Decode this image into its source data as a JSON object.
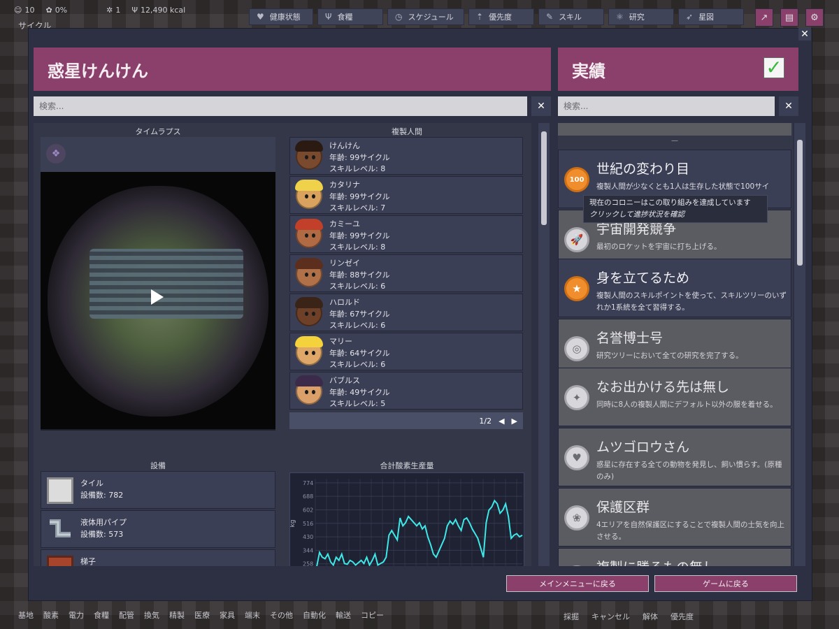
{
  "hud": {
    "stats": [
      {
        "icon": "duplicant-icon",
        "value": "10"
      },
      {
        "icon": "brain-icon",
        "value": "0%"
      },
      {
        "icon": "germ-icon",
        "value": "1"
      },
      {
        "icon": "fork-knife-icon",
        "value": "12,490 kcal"
      }
    ],
    "cycle_label": "サイクル",
    "buttons": [
      {
        "icon": "heart-icon",
        "label": "健康状態"
      },
      {
        "icon": "fork-knife-icon",
        "label": "食糧"
      },
      {
        "icon": "clock-icon",
        "label": "スケジュール"
      },
      {
        "icon": "priority-icon",
        "label": "優先度"
      },
      {
        "icon": "wrench-icon",
        "label": "スキル"
      },
      {
        "icon": "research-icon",
        "label": "研究"
      },
      {
        "icon": "rocket-icon",
        "label": "星図"
      }
    ]
  },
  "window": {
    "colony_name": "惑星けんけん",
    "achievements_title": "実績",
    "search_placeholder": "検索...",
    "close": "✕"
  },
  "left": {
    "timelapse_title": "タイムラプス",
    "duplicants_title": "複製人間",
    "duplicants": [
      {
        "name": "けんけん",
        "age": "年齢: 99サイクル",
        "skill": "スキルレベル: 8",
        "skin": "#7a4a2e",
        "hair": "#2a1a12"
      },
      {
        "name": "カタリナ",
        "age": "年齢: 99サイクル",
        "skill": "スキルレベル: 7",
        "skin": "#d9a25f",
        "hair": "#f0d24a"
      },
      {
        "name": "カミーユ",
        "age": "年齢: 99サイクル",
        "skill": "スキルレベル: 8",
        "skin": "#b06a44",
        "hair": "#c2402a"
      },
      {
        "name": "リンゼイ",
        "age": "年齢: 88サイクル",
        "skill": "スキルレベル: 6",
        "skin": "#b07048",
        "hair": "#5b2e1e"
      },
      {
        "name": "ハロルド",
        "age": "年齢: 67サイクル",
        "skill": "スキルレベル: 6",
        "skin": "#6e4028",
        "hair": "#3a2418"
      },
      {
        "name": "マリー",
        "age": "年齢: 64サイクル",
        "skill": "スキルレベル: 6",
        "skin": "#e0a868",
        "hair": "#f4d23c"
      },
      {
        "name": "バブルス",
        "age": "年齢: 49サイクル",
        "skill": "スキルレベル: 5",
        "skin": "#dba06a",
        "hair": "#3c2a4a"
      }
    ],
    "pager": "1/2",
    "buildings_title": "設備",
    "buildings": [
      {
        "name": "タイル",
        "count": "設備数: 782"
      },
      {
        "name": "液体用パイプ",
        "count": "設備数: 573"
      },
      {
        "name": "梯子",
        "count": ""
      }
    ],
    "oxygen_title": "合計酸素生産量"
  },
  "achievements": [
    {
      "title": "世紀の変わり目",
      "desc": "複製人間が少なくとも1人は生存した状態で100サイ",
      "done": true,
      "icon_text": "100"
    },
    {
      "title": "宇宙開発競争",
      "desc": "最初のロケットを宇宙に打ち上げる。",
      "done": false,
      "icon_text": "🚀"
    },
    {
      "title": "身を立てるため",
      "desc": "複製人間のスキルポイントを使って、スキルツリーのいずれか1系統を全て習得する。",
      "done": true,
      "icon_text": "★"
    },
    {
      "title": "名誉博士号",
      "desc": "研究ツリーにおいて全ての研究を完了する。",
      "done": false,
      "icon_text": "◎"
    },
    {
      "title": "なお出かける先は無し",
      "desc": "同時に8人の複製人間にデフォルト以外の服を着せる。",
      "done": false,
      "icon_text": "✦"
    },
    {
      "title": "ムツゴロウさん",
      "desc": "惑星に存在する全ての動物を発見し、飼い慣らす。(原種のみ)",
      "done": false,
      "icon_text": "♥"
    },
    {
      "title": "保護区群",
      "desc": "4エリアを自然保護区にすることで複製人間の士気を向上させる。",
      "done": false,
      "icon_text": "❀"
    },
    {
      "title": "複製に勝るもの無し",
      "desc": "",
      "done": false,
      "icon_text": "◯"
    }
  ],
  "tooltip": {
    "line1": "現在のコロニーはこの取り組みを達成しています",
    "line2": "クリックして進捗状況を確認"
  },
  "footer": {
    "main_menu": "メインメニューに戻る",
    "back_to_game": "ゲームに戻る"
  },
  "bottom_tools": [
    "基地",
    "酸素",
    "電力",
    "食糧",
    "配管",
    "換気",
    "精製",
    "医療",
    "家具",
    "端末",
    "その他",
    "自動化",
    "輸送",
    "コピー"
  ],
  "bottom_right_tools": [
    "採掘",
    "キャンセル",
    "解体",
    "優先度"
  ],
  "chart_data": {
    "type": "line",
    "title": "合計酸素生産量",
    "ylabel": "kg",
    "xlabel": "",
    "y_ticks": [
      774,
      688,
      602,
      516,
      430,
      344,
      258
    ],
    "ylim": [
      230,
      800
    ],
    "series": [
      {
        "color": "#3ee8e8",
        "values": [
          240,
          330,
          300,
          290,
          320,
          270,
          250,
          300,
          280,
          320,
          260,
          255,
          280,
          270,
          250,
          265,
          280,
          260,
          300,
          250,
          280,
          320,
          250,
          260,
          270,
          300,
          440,
          470,
          440,
          410,
          550,
          500,
          520,
          560,
          540,
          520,
          500,
          520,
          480,
          500,
          430,
          380,
          320,
          300,
          340,
          380,
          420,
          500,
          530,
          510,
          540,
          500,
          470,
          540,
          550,
          520,
          480,
          450,
          420,
          360,
          300,
          520,
          600,
          620,
          660,
          640,
          580,
          600,
          640,
          560,
          420,
          440,
          450,
          430,
          440
        ]
      }
    ]
  }
}
